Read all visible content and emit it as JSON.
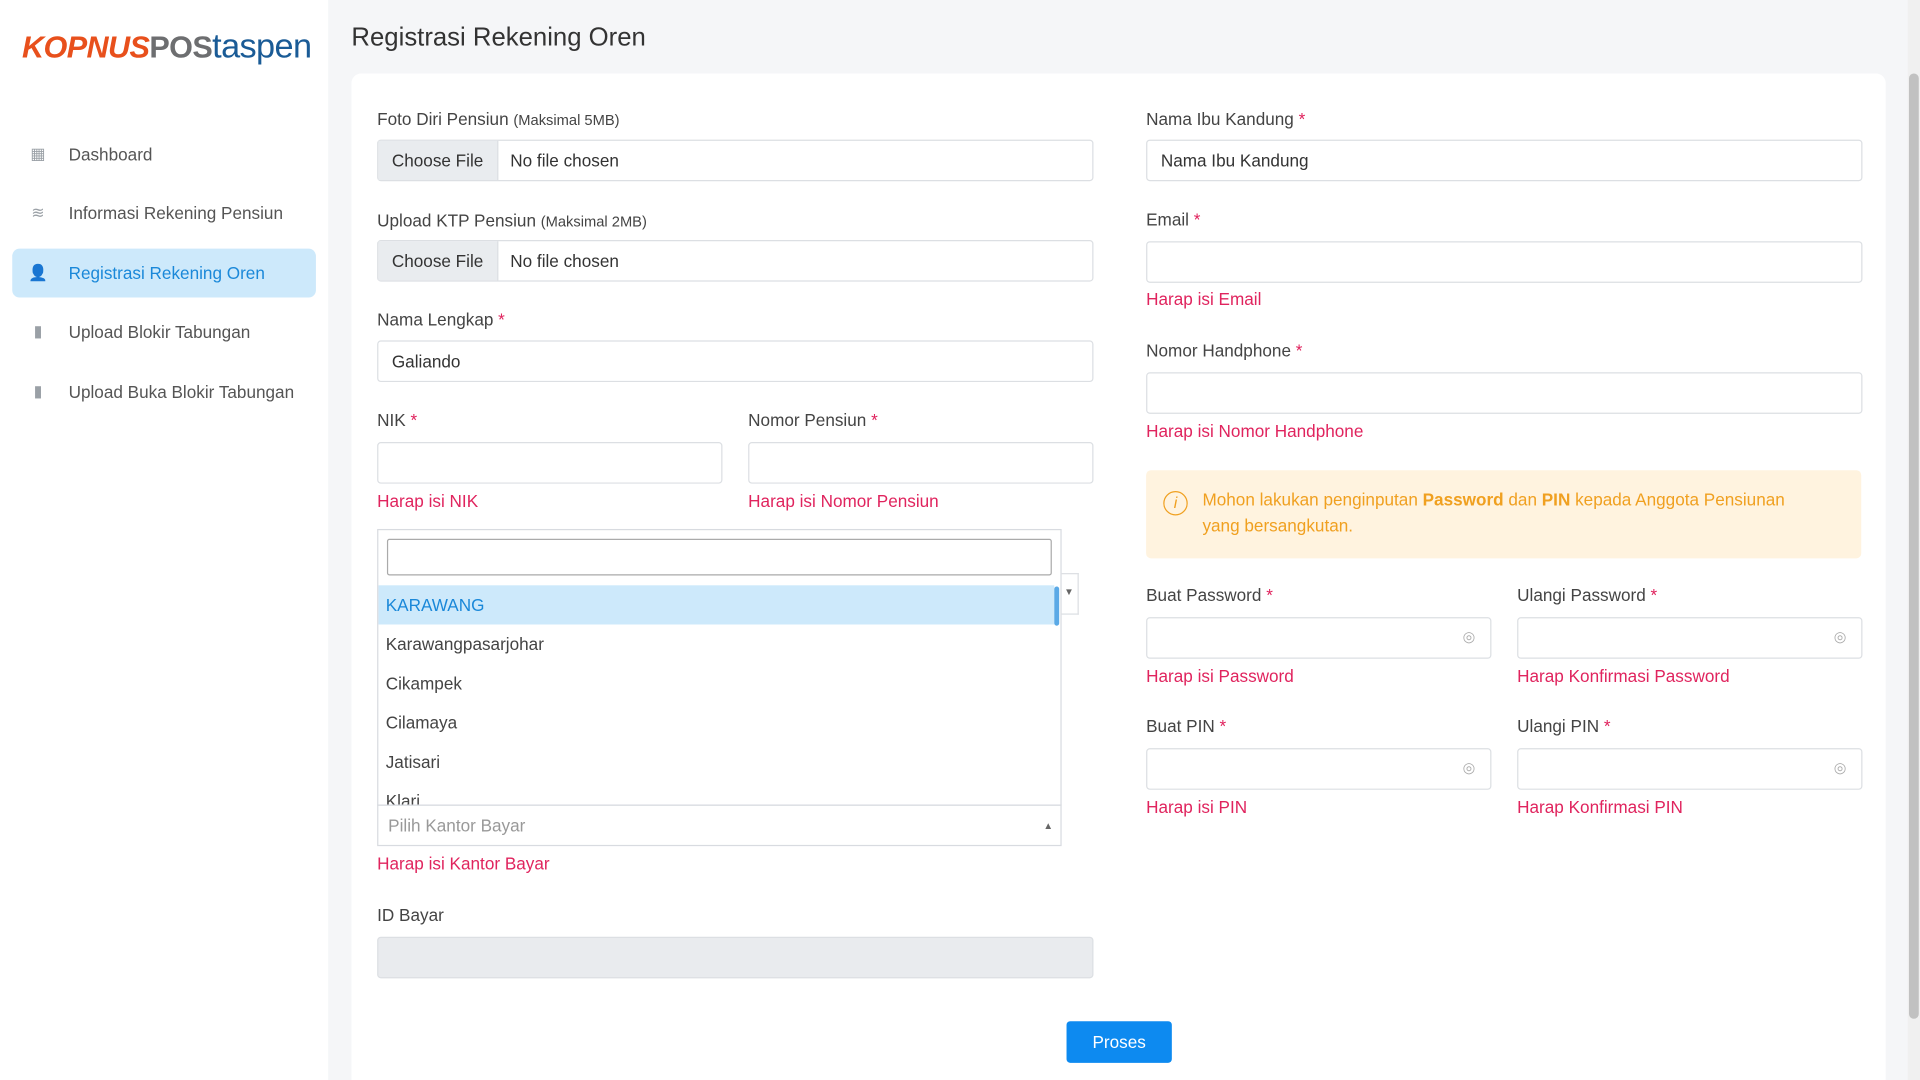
{
  "logo": {
    "part1": "KOPNUS",
    "part2": "POS",
    "part3": "taspen"
  },
  "page_title": "Registrasi Rekening Oren",
  "sidebar": {
    "items": [
      {
        "label": "Dashboard",
        "icon": "grid-icon"
      },
      {
        "label": "Informasi Rekening Pensiun",
        "icon": "layers-icon"
      },
      {
        "label": "Registrasi Rekening Oren",
        "icon": "user-plus-icon",
        "active": true
      },
      {
        "label": "Upload Blokir Tabungan",
        "icon": "file-upload-icon"
      },
      {
        "label": "Upload Buka Blokir Tabungan",
        "icon": "file-upload-icon"
      }
    ]
  },
  "form": {
    "foto": {
      "label": "Foto Diri Pensiun",
      "hint": "(Maksimal 5MB)",
      "button": "Choose File",
      "value": "No file chosen"
    },
    "ktp": {
      "label": "Upload KTP Pensiun",
      "hint": "(Maksimal 2MB)",
      "button": "Choose File",
      "value": "No file chosen"
    },
    "nama": {
      "label": "Nama Lengkap",
      "value": "Galiando"
    },
    "nik": {
      "label": "NIK",
      "value": "",
      "error": "Harap isi NIK"
    },
    "nomor_pensiun": {
      "label": "Nomor Pensiun",
      "value": "",
      "error": "Harap isi Nomor Pensiun"
    },
    "kantor_bayar": {
      "placeholder": "Pilih Kantor Bayar",
      "error": "Harap isi Kantor Bayar",
      "search": "",
      "options": [
        "KARAWANG",
        "Karawangpasarjohar",
        "Cikampek",
        "Cilamaya",
        "Jatisari",
        "Klari"
      ],
      "highlighted": "KARAWANG"
    },
    "id_bayar": {
      "label": "ID Bayar",
      "value": ""
    },
    "ibu": {
      "label": "Nama Ibu Kandung",
      "value": "Nama Ibu Kandung"
    },
    "email": {
      "label": "Email",
      "value": "",
      "error": "Harap isi Email"
    },
    "hp": {
      "label": "Nomor Handphone",
      "value": "",
      "error": "Harap isi Nomor Handphone"
    },
    "alert": {
      "pre": "Mohon lakukan penginputan ",
      "b1": "Password",
      "mid": " dan ",
      "b2": "PIN",
      "post": " kepada Anggota Pensiunan yang bersangkutan."
    },
    "password": {
      "label": "Buat Password",
      "error": "Harap isi Password"
    },
    "password2": {
      "label": "Ulangi Password",
      "error": "Harap Konfirmasi Password"
    },
    "pin": {
      "label": "Buat PIN",
      "error": "Harap isi PIN"
    },
    "pin2": {
      "label": "Ulangi PIN",
      "error": "Harap Konfirmasi PIN"
    },
    "required_mark": "*",
    "submit": "Proses"
  },
  "colors": {
    "primary": "#0d8af0",
    "error": "#e0245e",
    "warning": "#f0a020"
  }
}
